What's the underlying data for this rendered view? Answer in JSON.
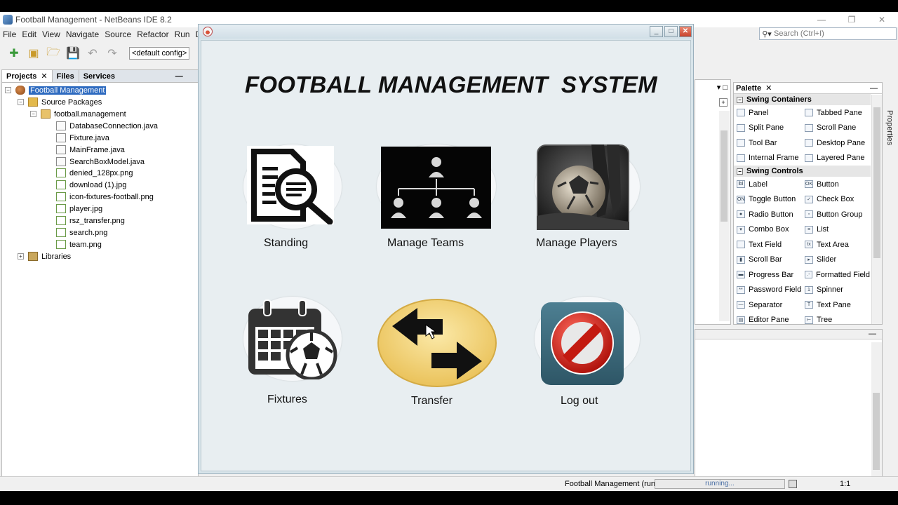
{
  "ide": {
    "title": "Football Management - NetBeans IDE 8.2",
    "window_controls": {
      "minimize": "—",
      "restore": "❐",
      "close": "✕"
    },
    "menu": [
      "File",
      "Edit",
      "View",
      "Navigate",
      "Source",
      "Refactor",
      "Run",
      "Debu"
    ],
    "search_placeholder": "Search (Ctrl+I)",
    "config": "<default config>"
  },
  "projects": {
    "tabs": [
      "Projects",
      "Files",
      "Services"
    ],
    "tree": {
      "root": "Football Management",
      "source_packages": "Source Packages",
      "package": "football.management",
      "files": [
        "DatabaseConnection.java",
        "Fixture.java",
        "MainFrame.java",
        "SearchBoxModel.java",
        "denied_128px.png",
        "download (1).jpg",
        "icon-fixtures-football.png",
        "player.jpg",
        "rsz_transfer.png",
        "search.png",
        "team.png"
      ],
      "libraries": "Libraries"
    }
  },
  "palette": {
    "title": "Palette",
    "side_label": "Properties",
    "categories": [
      {
        "name": "Swing Containers",
        "items": [
          "Panel",
          "Tabbed Pane",
          "Split Pane",
          "Scroll Pane",
          "Tool Bar",
          "Desktop Pane",
          "Internal Frame",
          "Layered Pane"
        ]
      },
      {
        "name": "Swing Controls",
        "items": [
          "Label",
          "Button",
          "Toggle Button",
          "Check Box",
          "Radio Button",
          "Button Group",
          "Combo Box",
          "List",
          "Text Field",
          "Text Area",
          "Scroll Bar",
          "Slider",
          "Progress Bar",
          "Formatted Field",
          "Password Field",
          "Spinner",
          "Separator",
          "Text Pane",
          "Editor Pane",
          "Tree"
        ]
      }
    ]
  },
  "status": {
    "project_run": "Football Management (run)",
    "progress_text": "running...",
    "position": "1:1"
  },
  "app": {
    "title": "FOOTBALL MANAGEMENT  SYSTEM",
    "tiles": [
      {
        "label": "Standing",
        "icon": "search-document-icon"
      },
      {
        "label": "Manage Teams",
        "icon": "org-chart-icon"
      },
      {
        "label": "Manage Players",
        "icon": "football-player-photo"
      },
      {
        "label": "Fixtures",
        "icon": "calendar-football-icon"
      },
      {
        "label": "Transfer",
        "icon": "transfer-arrows-icon"
      },
      {
        "label": "Log out",
        "icon": "denied-icon"
      }
    ]
  }
}
